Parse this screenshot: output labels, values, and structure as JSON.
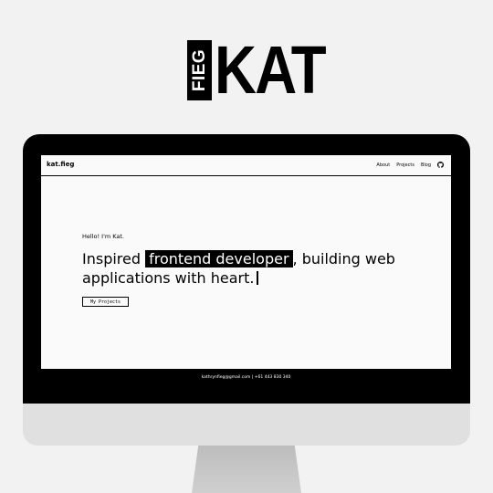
{
  "logo": {
    "side_text": "FIEG",
    "main_text": "KAT"
  },
  "nav": {
    "brand": "kat.fieg",
    "links": [
      "About",
      "Projects",
      "Blog"
    ],
    "github_icon": "github-icon"
  },
  "hero": {
    "greeting": "Hello! I'm Kat.",
    "title_before": "Inspired ",
    "title_highlight": "frontend developer",
    "title_after": ", building web applications with heart.",
    "button_label": "My Projects"
  },
  "footer": {
    "text": "kathrynfieg@gmail.com | +61 443 830 340"
  },
  "colors": {
    "background": "#f2f2f2",
    "monitor": "#000000",
    "screen": "#fafafa",
    "accent": "#000000"
  }
}
